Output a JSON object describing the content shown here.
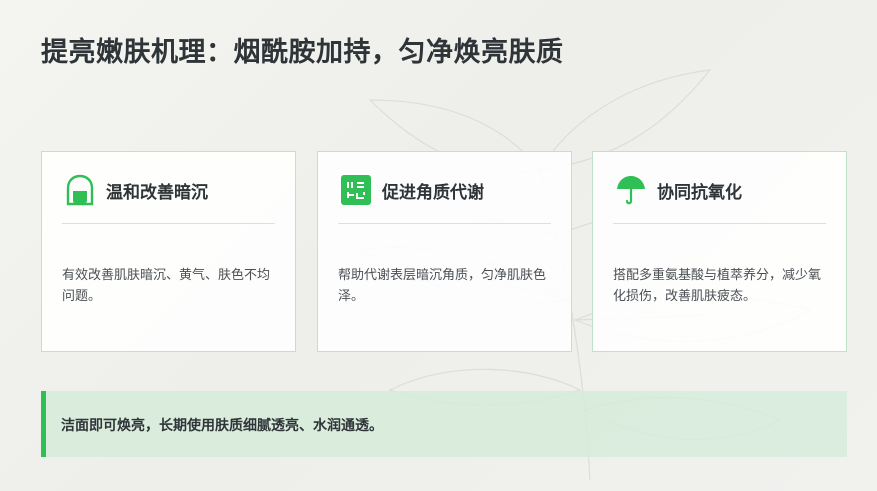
{
  "title": "提亮嫩肤机理：烟酰胺加持，匀净焕亮肤质",
  "colors": {
    "accent": "#2fbf54",
    "card_border": "#bfe3c8",
    "callout_bg": "#d6ecda"
  },
  "cards": [
    {
      "icon": "shield-icon",
      "title": "温和改善暗沉",
      "desc": "有效改善肌肤暗沉、黄气、肤色不均问题。"
    },
    {
      "icon": "grid-panel-icon",
      "title": "促进角质代谢",
      "desc": "帮助代谢表层暗沉角质，匀净肌肤色泽。"
    },
    {
      "icon": "umbrella-icon",
      "title": "协同抗氧化",
      "desc": "搭配多重氨基酸与植萃养分，减少氧化损伤，改善肌肤疲态。"
    }
  ],
  "callout": {
    "text": "洁面即可焕亮，长期使用肤质细腻透亮、水润通透。"
  }
}
